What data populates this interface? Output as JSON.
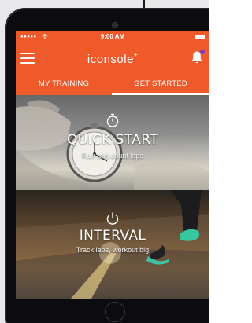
{
  "status_bar": {
    "signal": "●●●●●",
    "time": "9:00 AM"
  },
  "app_bar": {
    "logo_text": "iconsole",
    "logo_suffix": "+"
  },
  "tabs": [
    {
      "label": "MY TRAINING",
      "selected": false
    },
    {
      "label": "GET STARTED",
      "selected": true
    }
  ],
  "cards": {
    "quick_start": {
      "title": "QUICK START",
      "subtitle": "Run and count laps",
      "icon": "stopwatch-icon"
    },
    "interval": {
      "title": "INTERVAL",
      "subtitle": "Track laps, workout big",
      "icon": "power-icon"
    }
  },
  "colors": {
    "brand_orange": "#ef5a2b",
    "notification_dot": "#7a3cc7"
  }
}
